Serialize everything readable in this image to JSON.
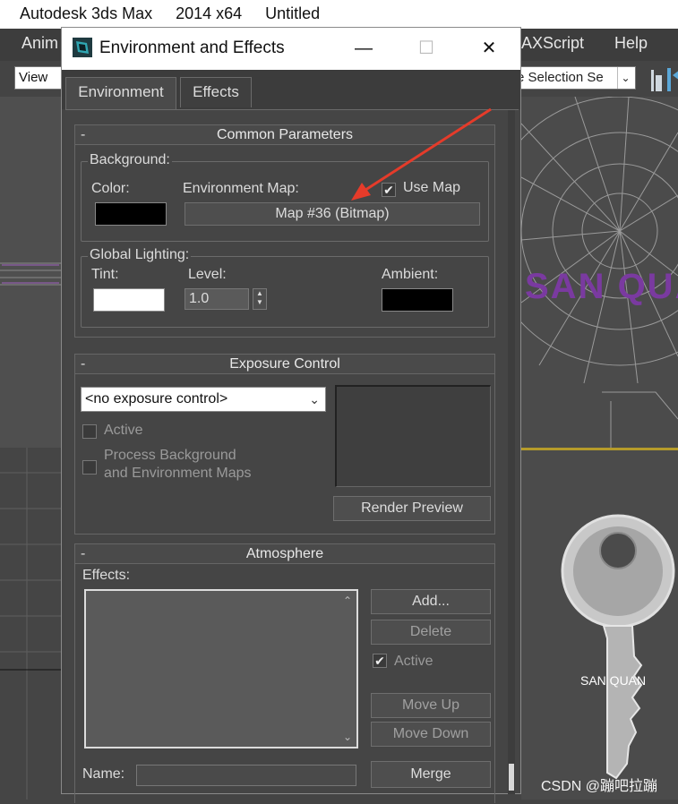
{
  "app": {
    "title_parts": [
      "Autodesk 3ds Max",
      "2014 x64",
      "Untitled"
    ],
    "menu": [
      "Anim",
      "AXScript",
      "Help"
    ],
    "view_select": "View",
    "selection_select": "e Selection Se",
    "san_quan": "SAN QUAN",
    "key_text": "SAN QUAN",
    "watermark": "CSDN @蹦吧拉蹦"
  },
  "dialog": {
    "title": "Environment and Effects",
    "minimize": "—",
    "maximize": "☐",
    "close": "✕",
    "tabs": [
      "Environment",
      "Effects"
    ],
    "common": {
      "header": "Common Parameters",
      "minus": "-",
      "background_label": "Background:",
      "color_label": "Color:",
      "env_map_label": "Environment Map:",
      "use_map_label": "Use Map",
      "use_map_checked": true,
      "map_button": "Map #36 (Bitmap)",
      "global_lighting_label": "Global Lighting:",
      "tint_label": "Tint:",
      "level_label": "Level:",
      "level_value": "1.0",
      "ambient_label": "Ambient:",
      "colors": {
        "background": "#000000",
        "tint": "#ffffff",
        "ambient": "#000000"
      }
    },
    "exposure": {
      "header": "Exposure Control",
      "minus": "-",
      "selected": "<no exposure control>",
      "active_label": "Active",
      "process_label_1": "Process Background",
      "process_label_2": "and Environment Maps",
      "render_preview": "Render Preview"
    },
    "atmosphere": {
      "header": "Atmosphere",
      "minus": "-",
      "effects_label": "Effects:",
      "add": "Add...",
      "delete": "Delete",
      "active_label": "Active",
      "active_checked": true,
      "move_up": "Move Up",
      "move_down": "Move Down",
      "name_label": "Name:",
      "merge": "Merge"
    }
  }
}
